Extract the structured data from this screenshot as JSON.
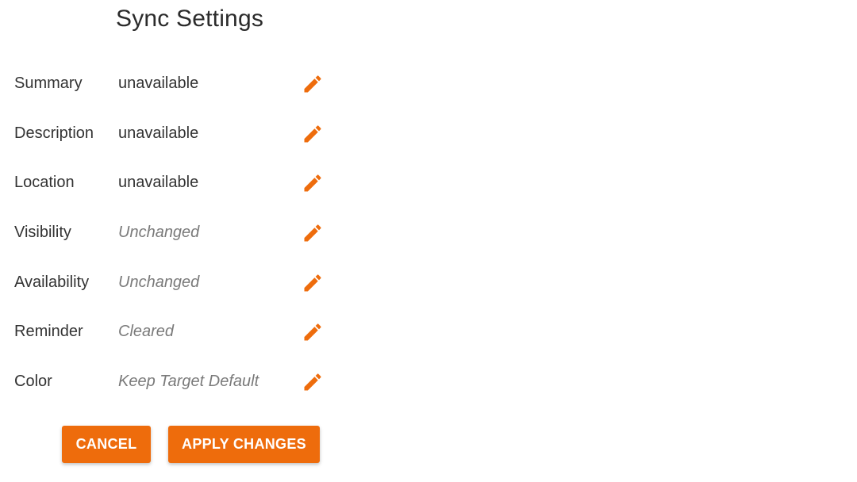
{
  "page": {
    "title": "Sync Settings"
  },
  "settings": [
    {
      "label": "Summary",
      "value": "unavailable",
      "muted": false
    },
    {
      "label": "Description",
      "value": "unavailable",
      "muted": false
    },
    {
      "label": "Location",
      "value": "unavailable",
      "muted": false
    },
    {
      "label": "Visibility",
      "value": "Unchanged",
      "muted": true
    },
    {
      "label": "Availability",
      "value": "Unchanged",
      "muted": true
    },
    {
      "label": "Reminder",
      "value": "Cleared",
      "muted": true
    },
    {
      "label": "Color",
      "value": "Keep Target Default",
      "muted": true
    }
  ],
  "actions": {
    "cancel_label": "CANCEL",
    "apply_label": "APPLY CHANGES"
  },
  "icons": {
    "edit": "pencil-icon"
  },
  "colors": {
    "accent": "#ee6c0c",
    "text": "#333333",
    "muted_text": "#7a7a7a"
  }
}
